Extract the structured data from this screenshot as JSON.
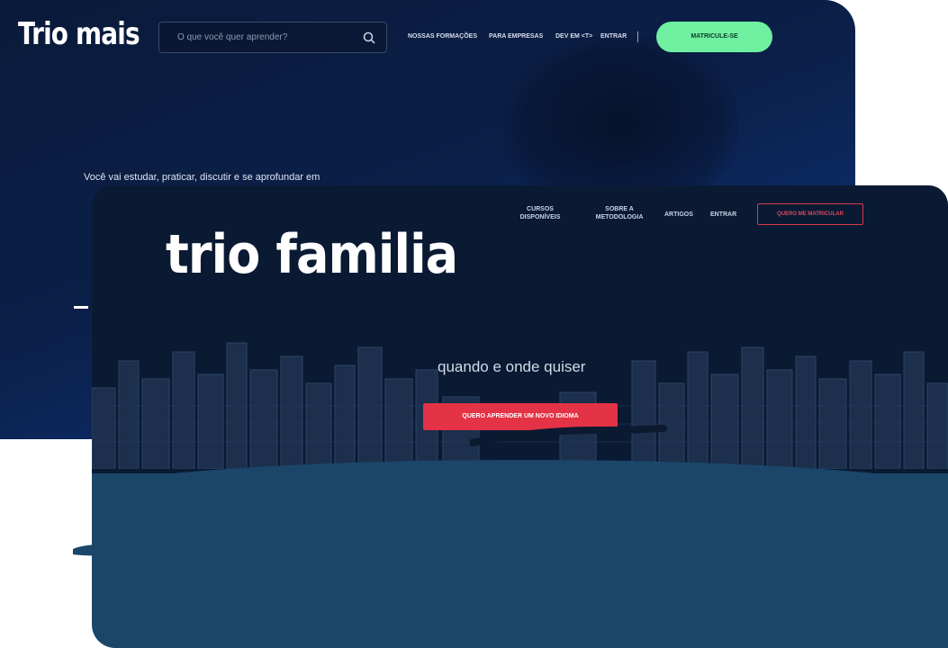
{
  "back_window": {
    "brand": "Trio mais",
    "search": {
      "placeholder": "O que você quer aprender?",
      "icon": "search-icon"
    },
    "nav": [
      "NOSSAS FORMAÇÕES",
      "PARA EMPRESAS",
      "DEV EM <T>",
      "ENTRAR"
    ],
    "cta": "MATRICULE-SE",
    "hero_text": "Você vai estudar, praticar, discutir e se aprofundar em"
  },
  "front_window": {
    "brand": "trio familia",
    "nav": {
      "courses": "CURSOS DISPONÍVEIS",
      "method": "SOBRE A METODOLOGIA",
      "articles": "ARTIGOS",
      "login": "ENTRAR"
    },
    "cta_outline": "QUERO ME MATRICULAR",
    "subtitle": "quando e onde quiser",
    "cta_main": "QUERO APRENDER UM NOVO IDIOMA"
  },
  "colors": {
    "back_bg": "#0b1f48",
    "front_bg": "#0a1a33",
    "front_lower": "#1b4669",
    "green_cta": "#6ff0a0",
    "red_cta": "#e43246"
  }
}
